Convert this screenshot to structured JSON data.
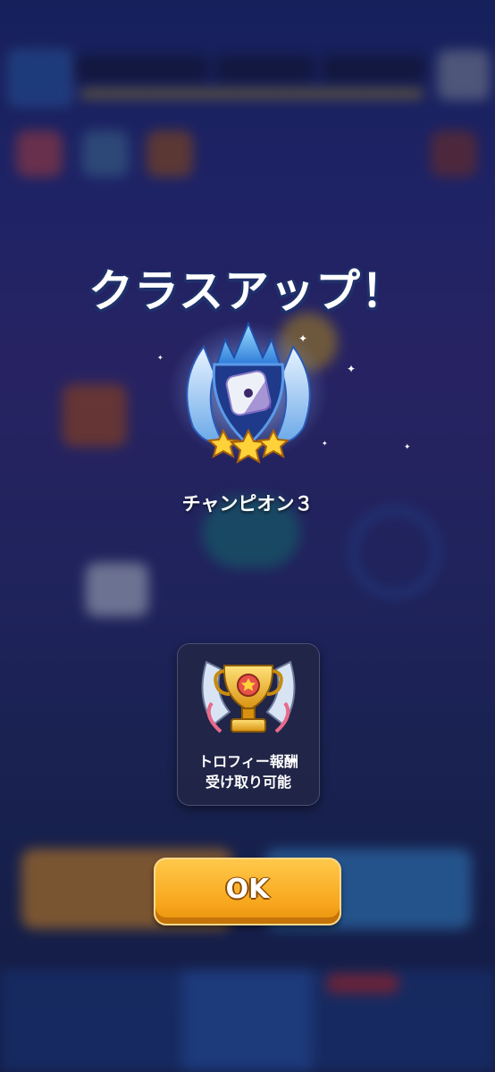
{
  "popup": {
    "title": "クラスアップ！",
    "rank_name": "チャンピオン３",
    "rank_stars": 3,
    "reward": {
      "line1": "トロフィー報酬",
      "line2": "受け取り可能"
    },
    "ok_label": "OK"
  },
  "icons": {
    "rank_badge": "champion-badge-icon",
    "trophy": "gold-trophy-icon",
    "sparkle": "sparkle-icon"
  },
  "colors": {
    "ok_button": "#f7a61c",
    "title_outline": "#20306a",
    "trophy_gold": "#f2b81e",
    "background": "#2a2f8c"
  }
}
